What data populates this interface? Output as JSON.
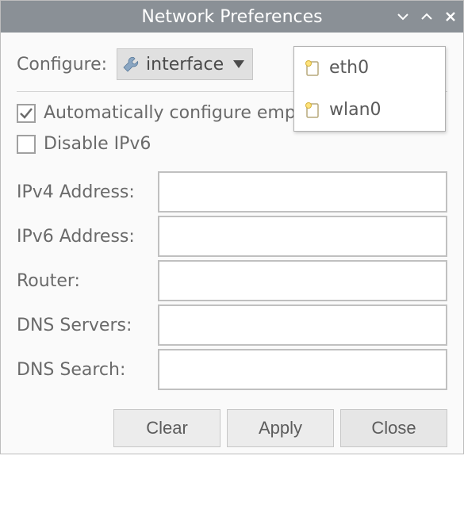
{
  "window": {
    "title": "Network Preferences"
  },
  "configure": {
    "label": "Configure:",
    "combo_text": "interface"
  },
  "dropdown": {
    "items": [
      "eth0",
      "wlan0"
    ]
  },
  "checks": {
    "auto_label": "Automatically configure empty options",
    "auto_checked": true,
    "ipv6_label": "Disable IPv6",
    "ipv6_checked": false
  },
  "fields": {
    "ipv4_label": "IPv4 Address:",
    "ipv4_value": "",
    "ipv6_label": "IPv6 Address:",
    "ipv6_value": "",
    "router_label": "Router:",
    "router_value": "",
    "dns_servers_label": "DNS Servers:",
    "dns_servers_value": "",
    "dns_search_label": "DNS Search:",
    "dns_search_value": ""
  },
  "buttons": {
    "clear": "Clear",
    "apply": "Apply",
    "close": "Close"
  }
}
